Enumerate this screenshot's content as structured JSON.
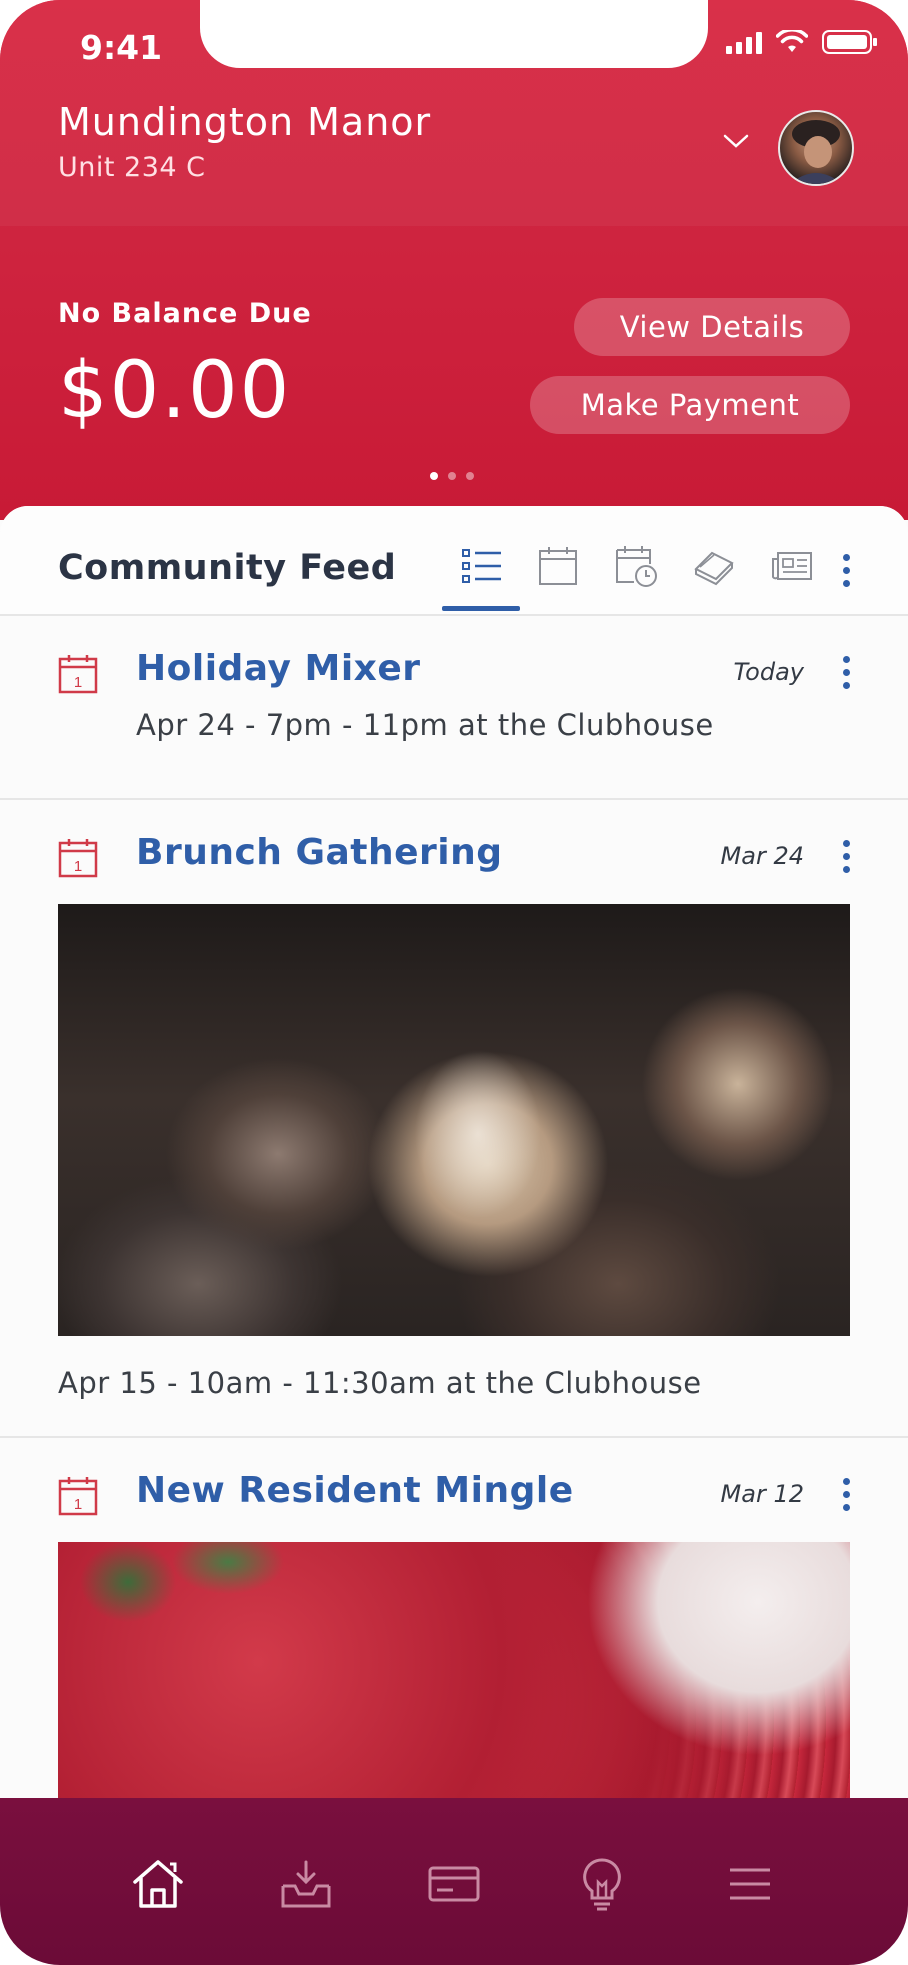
{
  "status_bar": {
    "time": "9:41"
  },
  "header": {
    "community_name": "Mundington Manor",
    "unit": "Unit 234 C",
    "balance_label": "No Balance Due",
    "balance_amount": "$0.00",
    "view_details_label": "View Details",
    "make_payment_label": "Make Payment",
    "carousel_page": 1,
    "carousel_total": 3
  },
  "feed": {
    "title": "Community Feed",
    "tabs": [
      {
        "icon": "list-icon",
        "active": true
      },
      {
        "icon": "calendar-icon",
        "active": false
      },
      {
        "icon": "calendar-clock-icon",
        "active": false
      },
      {
        "icon": "stack-icon",
        "active": false
      },
      {
        "icon": "newspaper-icon",
        "active": false
      }
    ],
    "items": [
      {
        "title": "Holiday Mixer",
        "date": "Today",
        "description": "Apr 24 - 7pm - 11pm at the Clubhouse",
        "calendar_day": "1"
      },
      {
        "title": "Brunch Gathering",
        "date": "Mar 24",
        "description": "Apr 15 - 10am - 11:30am at the Clubhouse",
        "calendar_day": "1"
      },
      {
        "title": "New Resident Mingle",
        "date": "Mar 12",
        "calendar_day": "1"
      }
    ]
  },
  "bottom_nav": [
    {
      "icon": "home-icon",
      "active": true
    },
    {
      "icon": "inbox-download-icon",
      "active": false
    },
    {
      "icon": "credit-card-icon",
      "active": false
    },
    {
      "icon": "lightbulb-icon",
      "active": false
    },
    {
      "icon": "menu-icon",
      "active": false
    }
  ],
  "colors": {
    "header_red": "#cf2540",
    "accent_blue": "#2f5ea8",
    "calendar_red": "#d03a48",
    "nav_maroon": "#6b0b37"
  }
}
